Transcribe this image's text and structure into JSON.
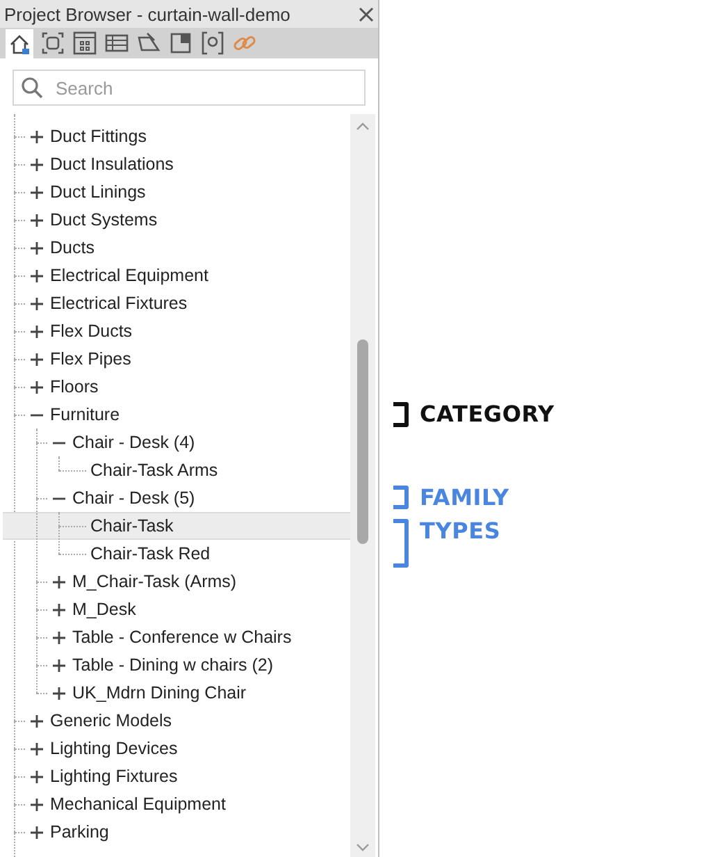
{
  "window": {
    "title": "Project Browser - curtain-wall-demo"
  },
  "search": {
    "placeholder": "Search"
  },
  "tree": [
    {
      "label": "Duct Fittings",
      "expanded": false,
      "selected": false
    },
    {
      "label": "Duct Insulations",
      "expanded": false,
      "selected": false
    },
    {
      "label": "Duct Linings",
      "expanded": false,
      "selected": false
    },
    {
      "label": "Duct Systems",
      "expanded": false,
      "selected": false
    },
    {
      "label": "Ducts",
      "expanded": false,
      "selected": false
    },
    {
      "label": "Electrical Equipment",
      "expanded": false,
      "selected": false
    },
    {
      "label": "Electrical Fixtures",
      "expanded": false,
      "selected": false
    },
    {
      "label": "Flex Ducts",
      "expanded": false,
      "selected": false
    },
    {
      "label": "Flex Pipes",
      "expanded": false,
      "selected": false
    },
    {
      "label": "Floors",
      "expanded": false,
      "selected": false
    },
    {
      "label": "Furniture",
      "expanded": true,
      "selected": false,
      "children": [
        {
          "label": "Chair - Desk (4)",
          "expanded": true,
          "selected": false,
          "children": [
            {
              "label": "Chair-Task Arms",
              "selected": false
            }
          ]
        },
        {
          "label": "Chair - Desk (5)",
          "expanded": true,
          "selected": false,
          "children": [
            {
              "label": "Chair-Task",
              "selected": true
            },
            {
              "label": "Chair-Task Red",
              "selected": false
            }
          ]
        },
        {
          "label": "M_Chair-Task (Arms)",
          "expanded": false,
          "selected": false
        },
        {
          "label": "M_Desk",
          "expanded": false,
          "selected": false
        },
        {
          "label": "Table - Conference w Chairs",
          "expanded": false,
          "selected": false
        },
        {
          "label": "Table - Dining w chairs (2)",
          "expanded": false,
          "selected": false
        },
        {
          "label": "UK_Mdrn Dining Chair",
          "expanded": false,
          "selected": false
        }
      ]
    },
    {
      "label": "Generic Models",
      "expanded": false,
      "selected": false
    },
    {
      "label": "Lighting Devices",
      "expanded": false,
      "selected": false
    },
    {
      "label": "Lighting Fixtures",
      "expanded": false,
      "selected": false
    },
    {
      "label": "Mechanical Equipment",
      "expanded": false,
      "selected": false
    },
    {
      "label": "Parking",
      "expanded": false,
      "selected": false
    }
  ],
  "annotations": [
    {
      "label": "CATEGORY",
      "color": "#111111"
    },
    {
      "label": "FAMILY",
      "color": "#4a86e0"
    },
    {
      "label": "TYPES",
      "color": "#4a86e0"
    }
  ]
}
